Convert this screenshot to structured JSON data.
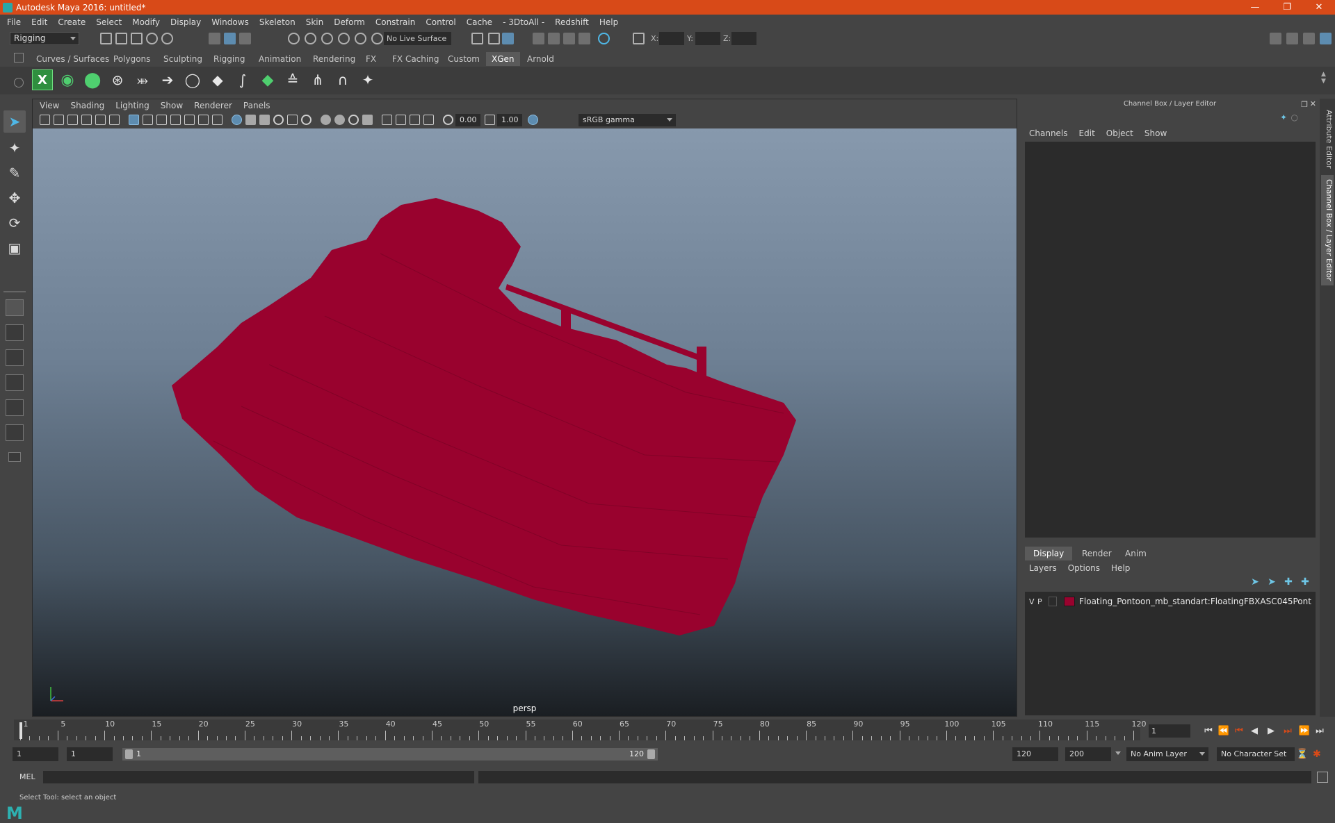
{
  "window": {
    "title": "Autodesk Maya 2016: untitled*"
  },
  "menubar": [
    "File",
    "Edit",
    "Create",
    "Select",
    "Modify",
    "Display",
    "Windows",
    "Skeleton",
    "Skin",
    "Deform",
    "Constrain",
    "Control",
    "Cache",
    "- 3DtoAll -",
    "Redshift",
    "Help"
  ],
  "status": {
    "mode": "Rigging",
    "live_surface": "No Live Surface",
    "x_label": "X:",
    "y_label": "Y:",
    "z_label": "Z:"
  },
  "shelf": {
    "tabs": [
      "Curves / Surfaces",
      "Polygons",
      "Sculpting",
      "Rigging",
      "Animation",
      "Rendering",
      "FX",
      "FX Caching",
      "Custom",
      "XGen",
      "Arnold"
    ],
    "active_tab": "XGen"
  },
  "viewport": {
    "menu": [
      "View",
      "Shading",
      "Lighting",
      "Show",
      "Renderer",
      "Panels"
    ],
    "exposure": "0.00",
    "gamma": "1.00",
    "color_space": "sRGB gamma",
    "camera": "persp",
    "model_color": "#99022e"
  },
  "right_panel": {
    "title": "Channel Box / Layer Editor",
    "menu": [
      "Channels",
      "Edit",
      "Object",
      "Show"
    ],
    "layer_tabs": [
      "Display",
      "Render",
      "Anim"
    ],
    "active_layer_tab": "Display",
    "layer_menu": [
      "Layers",
      "Options",
      "Help"
    ],
    "layer": {
      "v": "V",
      "p": "P",
      "name": "Floating_Pontoon_mb_standart:FloatingFBXASC045Pont",
      "color": "#99022e"
    },
    "side_tabs": [
      "Attribute Editor",
      "Channel Box / Layer Editor"
    ]
  },
  "timeline": {
    "ticks": [
      "1",
      "5",
      "10",
      "15",
      "20",
      "25",
      "30",
      "35",
      "40",
      "45",
      "50",
      "55",
      "60",
      "65",
      "70",
      "75",
      "80",
      "85",
      "90",
      "95",
      "100",
      "105",
      "110",
      "115",
      "120"
    ],
    "current_frame": "1"
  },
  "range": {
    "start": "1",
    "playback_start": "1",
    "slider_start": "1",
    "slider_end": "120",
    "playback_end": "120",
    "end": "200",
    "anim_layer": "No Anim Layer",
    "character_set": "No Character Set"
  },
  "cmdline": {
    "label": "MEL"
  },
  "helpline": {
    "text": "Select Tool: select an object"
  }
}
